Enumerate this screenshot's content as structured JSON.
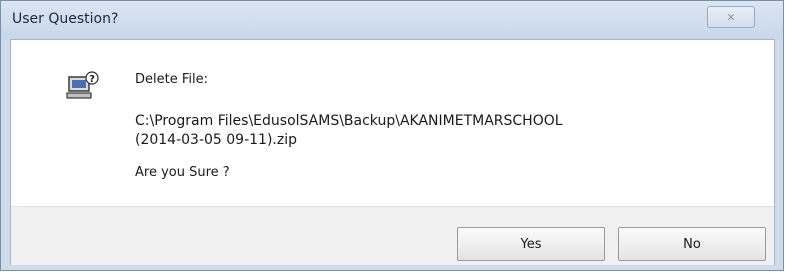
{
  "window": {
    "title": "User Question?",
    "close_icon": "close-icon"
  },
  "message": {
    "icon": "computer-question-icon",
    "heading": "Delete File:",
    "path_line1": "C:\\Program Files\\EdusolSAMS\\Backup\\AKANIMETMARSCHOOL",
    "path_line2": "(2014-03-05 09-11).zip",
    "question": "Are you Sure ?"
  },
  "buttons": {
    "yes_label": "Yes",
    "no_label": "No"
  }
}
